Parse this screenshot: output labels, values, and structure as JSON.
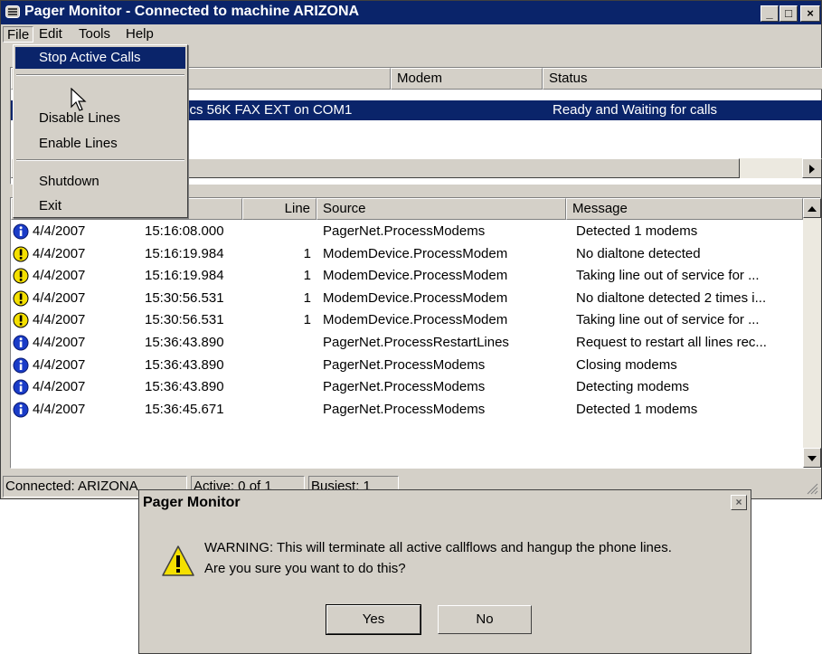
{
  "window": {
    "title": "Pager Monitor - Connected to machine ARIZONA",
    "minimize_glyph": "_",
    "maximize_glyph": "□",
    "close_glyph": "×"
  },
  "menubar": {
    "items": [
      "File",
      "Edit",
      "Tools",
      "Help"
    ]
  },
  "file_menu": {
    "stop_active_calls": "Stop Active Calls",
    "disable_lines": "Disable Lines",
    "enable_lines": "Enable Lines",
    "shutdown": "Shutdown",
    "exit": "Exit"
  },
  "lines_table": {
    "headers": {
      "modem": "Modem",
      "status": "Status"
    },
    "rows": [
      {
        "modem": "tics 56K FAX EXT on COM1",
        "status": "Ready and Waiting for calls"
      }
    ]
  },
  "log_table": {
    "headers": {
      "line": "Line",
      "source": "Source",
      "message": "Message"
    },
    "rows": [
      {
        "icon": "info",
        "date": "4/4/2007",
        "time": "15:16:08.000",
        "line": "",
        "source": "PagerNet.ProcessModems",
        "message": "Detected 1  modems"
      },
      {
        "icon": "warning",
        "date": "4/4/2007",
        "time": "15:16:19.984",
        "line": "1",
        "source": "ModemDevice.ProcessModem",
        "message": "No dialtone detected"
      },
      {
        "icon": "warning",
        "date": "4/4/2007",
        "time": "15:16:19.984",
        "line": "1",
        "source": "ModemDevice.ProcessModem",
        "message": "Taking line out of service for ..."
      },
      {
        "icon": "warning",
        "date": "4/4/2007",
        "time": "15:30:56.531",
        "line": "1",
        "source": "ModemDevice.ProcessModem",
        "message": "No dialtone detected 2 times i..."
      },
      {
        "icon": "warning",
        "date": "4/4/2007",
        "time": "15:30:56.531",
        "line": "1",
        "source": "ModemDevice.ProcessModem",
        "message": "Taking line out of service for ..."
      },
      {
        "icon": "info",
        "date": "4/4/2007",
        "time": "15:36:43.890",
        "line": "",
        "source": "PagerNet.ProcessRestartLines",
        "message": "Request to restart all lines rec..."
      },
      {
        "icon": "info",
        "date": "4/4/2007",
        "time": "15:36:43.890",
        "line": "",
        "source": "PagerNet.ProcessModems",
        "message": "Closing modems"
      },
      {
        "icon": "info",
        "date": "4/4/2007",
        "time": "15:36:43.890",
        "line": "",
        "source": "PagerNet.ProcessModems",
        "message": "Detecting modems"
      },
      {
        "icon": "info",
        "date": "4/4/2007",
        "time": "15:36:45.671",
        "line": "",
        "source": "PagerNet.ProcessModems",
        "message": "Detected 1  modems"
      }
    ]
  },
  "statusbar": {
    "connected": "Connected: ARIZONA",
    "active": "Active: 0 of 1",
    "busiest": "Busiest: 1"
  },
  "dialog": {
    "title": "Pager Monitor",
    "close_glyph": "×",
    "message_line1": "WARNING: This will terminate all active callflows and hangup the phone lines.",
    "message_line2": "Are you sure you want to do this?",
    "yes_label": "Yes",
    "no_label": "No"
  },
  "colors": {
    "titlebar": "#0a246a",
    "selection": "#0a246a",
    "info_icon": "#1a3cc8",
    "warning_icon": "#f4e000"
  }
}
